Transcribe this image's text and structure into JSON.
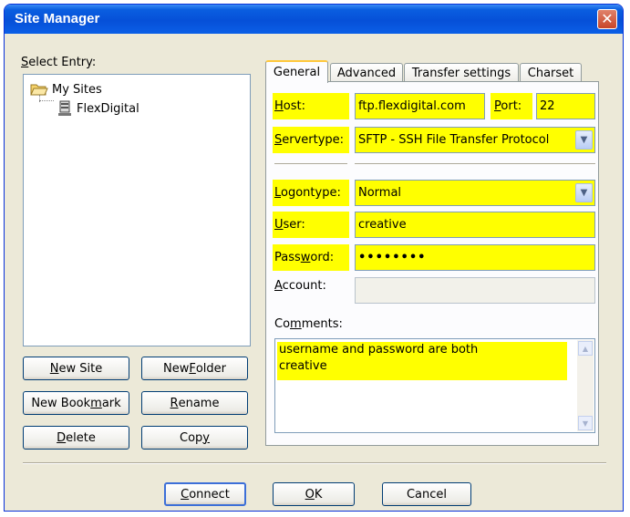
{
  "window": {
    "title": "Site Manager",
    "close_glyph": "✕"
  },
  "left": {
    "select_entry_label": "Select Entry:",
    "tree": {
      "root": {
        "label": "My Sites",
        "icon": "folder-open-icon"
      },
      "child": {
        "label": "FlexDigital",
        "icon": "server-icon"
      }
    },
    "buttons": {
      "new_site": "New Site",
      "new_folder": "New Folder",
      "new_bookmark": "New Bookmark",
      "rename": "Rename",
      "delete": "Delete",
      "copy": "Copy"
    }
  },
  "tabs": [
    {
      "label": "General",
      "active": true
    },
    {
      "label": "Advanced",
      "active": false
    },
    {
      "label": "Transfer settings",
      "active": false
    },
    {
      "label": "Charset",
      "active": false
    }
  ],
  "general": {
    "host_label": "Host:",
    "host_value": "ftp.flexdigital.com",
    "port_label": "Port:",
    "port_value": "22",
    "servertype_label": "Servertype:",
    "servertype_value": "SFTP - SSH File Transfer Protocol",
    "logontype_label": "Logontype:",
    "logontype_value": "Normal",
    "user_label": "User:",
    "user_value": "creative",
    "password_label": "Password:",
    "password_value": "••••••••",
    "account_label": "Account:",
    "account_value": "",
    "comments_label": "Comments:",
    "comments_line1": "username and password are both",
    "comments_line2": "creative"
  },
  "footer": {
    "connect": "Connect",
    "ok": "OK",
    "cancel": "Cancel"
  },
  "colors": {
    "highlight": "#ffff00",
    "titlebar": "#0650d8",
    "dialog_bg": "#ece9d8"
  }
}
